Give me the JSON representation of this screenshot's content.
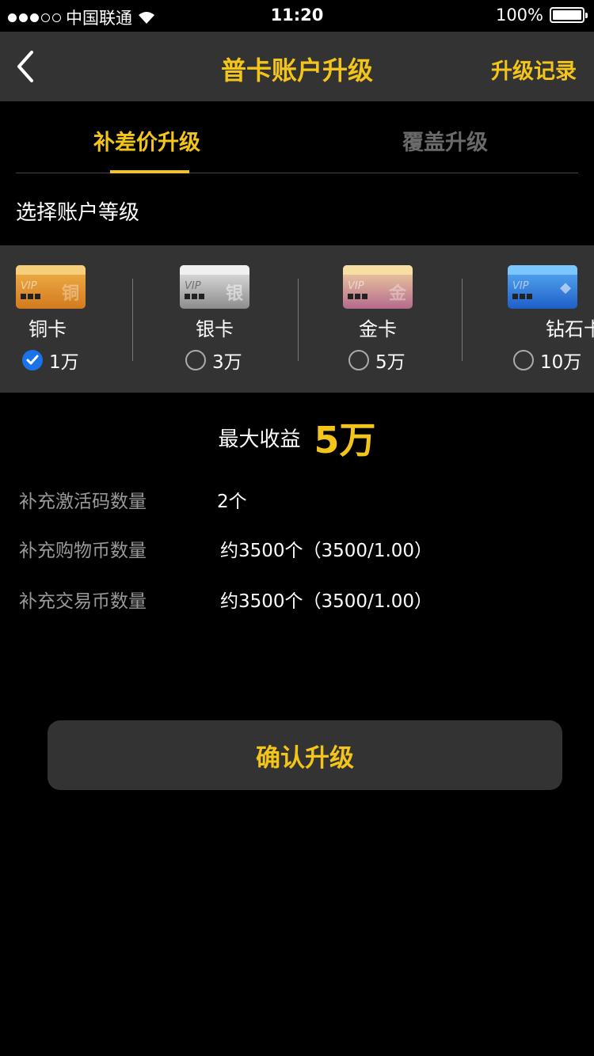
{
  "status_bar": {
    "carrier": "中国联通",
    "time": "11:20",
    "battery": "100%",
    "signal_icon": "signal-dots-icon",
    "wifi_icon": "wifi-icon",
    "battery_icon": "battery-icon"
  },
  "nav": {
    "back_icon": "chevron-left-icon",
    "title": "普卡账户升级",
    "right_action": "升级记录"
  },
  "tabs": [
    {
      "label": "补差价升级",
      "active": true
    },
    {
      "label": "覆盖升级",
      "active": false
    }
  ],
  "section_label": "选择账户等级",
  "cards": [
    {
      "name": "铜卡",
      "amount": "1万",
      "selected": true,
      "icon": "copper-card-icon",
      "vip": "VIP",
      "glyph": "铜",
      "color": "#d68a2a"
    },
    {
      "name": "银卡",
      "amount": "3万",
      "selected": false,
      "icon": "silver-card-icon",
      "vip": "VIP",
      "glyph": "银",
      "color": "#9a9a9a"
    },
    {
      "name": "金卡",
      "amount": "5万",
      "selected": false,
      "icon": "gold-card-icon",
      "vip": "VIP",
      "glyph": "金",
      "color": "#c9866c"
    },
    {
      "name": "钻石卡",
      "amount": "10万",
      "selected": false,
      "icon": "diamond-card-icon",
      "vip": "VIP",
      "glyph": "◆",
      "color": "#2e77d6"
    }
  ],
  "income": {
    "label": "最大收益",
    "value": "5万"
  },
  "info_rows": [
    {
      "label": "补充激活码数量",
      "value": "2个"
    },
    {
      "label": "补充购物币数量",
      "value": "约3500个（3500/1.00）"
    },
    {
      "label": "补充交易币数量",
      "value": "约3500个（3500/1.00）"
    }
  ],
  "confirm_button": "确认升级",
  "colors": {
    "accent": "#f3c51b",
    "panel": "#333333",
    "background": "#000000",
    "check": "#1a73e8"
  }
}
